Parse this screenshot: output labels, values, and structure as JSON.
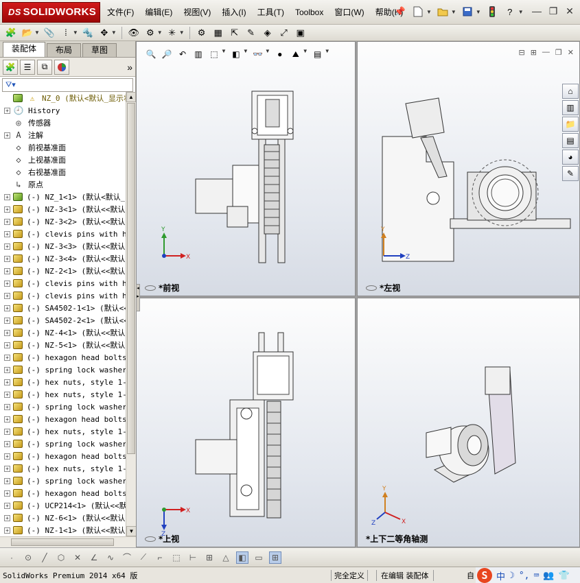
{
  "app": {
    "logo_text": "SOLIDWORKS",
    "logo_mark": "DS"
  },
  "menu": [
    "文件(F)",
    "编辑(E)",
    "视图(V)",
    "插入(I)",
    "工具(T)",
    "Toolbox",
    "窗口(W)",
    "帮助(H)"
  ],
  "left_tabs": {
    "assembly": "装配体",
    "layout": "布局",
    "sketch": "草图"
  },
  "tree": {
    "root": "NZ_0  (默认<默认_显示状",
    "items": [
      {
        "label": "History",
        "icon": "history-icon",
        "expand": true
      },
      {
        "label": "传感器",
        "icon": "sensor-icon",
        "expand": false
      },
      {
        "label": "注解",
        "icon": "annotation-icon",
        "expand": true
      },
      {
        "label": "前视基准面",
        "icon": "plane-icon",
        "expand": false
      },
      {
        "label": "上视基准面",
        "icon": "plane-icon",
        "expand": false
      },
      {
        "label": "右视基准面",
        "icon": "plane-icon",
        "expand": false
      },
      {
        "label": "原点",
        "icon": "origin-icon",
        "expand": false
      },
      {
        "label": "(-) NZ_1<1> (默认<默认_",
        "icon": "subassembly-icon",
        "expand": true
      },
      {
        "label": "(-) NZ-3<1> (默认<<默认",
        "icon": "part-icon",
        "expand": true
      },
      {
        "label": "(-) NZ-3<2> (默认<<默认",
        "icon": "part-icon",
        "expand": true
      },
      {
        "label": "(-) clevis pins with he",
        "icon": "part-icon",
        "expand": true
      },
      {
        "label": "(-) NZ-3<3> (默认<<默认",
        "icon": "part-icon",
        "expand": true
      },
      {
        "label": "(-) NZ-3<4> (默认<<默认",
        "icon": "part-icon",
        "expand": true
      },
      {
        "label": "(-) NZ-2<1> (默认<<默认",
        "icon": "part-icon",
        "expand": true
      },
      {
        "label": "(-) clevis pins with he",
        "icon": "part-icon",
        "expand": true
      },
      {
        "label": "(-) clevis pins with he",
        "icon": "part-icon",
        "expand": true
      },
      {
        "label": "(-) SA4502-1<1> (默认<<",
        "icon": "part-icon",
        "expand": true
      },
      {
        "label": "(-) SA4502-2<1> (默认<<",
        "icon": "part-icon",
        "expand": true
      },
      {
        "label": "(-) NZ-4<1> (默认<<默认",
        "icon": "part-icon",
        "expand": true
      },
      {
        "label": "(-) NZ-5<1> (默认<<默认",
        "icon": "part-icon",
        "expand": true
      },
      {
        "label": "(-) hexagon head bolts-",
        "icon": "part-icon",
        "expand": true
      },
      {
        "label": "(-) spring lock washers",
        "icon": "part-icon",
        "expand": true
      },
      {
        "label": "(-) hex nuts, style 1-g",
        "icon": "part-icon",
        "expand": true
      },
      {
        "label": "(-) hex nuts, style 1-g",
        "icon": "part-icon",
        "expand": true
      },
      {
        "label": "(-) spring lock washers",
        "icon": "part-icon",
        "expand": true
      },
      {
        "label": "(-) hexagon head bolts-",
        "icon": "part-icon",
        "expand": true
      },
      {
        "label": "(-) hex nuts, style 1-g",
        "icon": "part-icon",
        "expand": true
      },
      {
        "label": "(-) spring lock washers",
        "icon": "part-icon",
        "expand": true
      },
      {
        "label": "(-) hexagon head bolts-",
        "icon": "part-icon",
        "expand": true
      },
      {
        "label": "(-) hex nuts, style 1-g",
        "icon": "part-icon",
        "expand": true
      },
      {
        "label": "(-) spring lock washers",
        "icon": "part-icon",
        "expand": true
      },
      {
        "label": "(-) hexagon head bolts-",
        "icon": "part-icon",
        "expand": true
      },
      {
        "label": "(-) UCP214<1> (默认<<默",
        "icon": "part-icon",
        "expand": true
      },
      {
        "label": "(-) NZ-6<1> (默认<<默认",
        "icon": "part-icon",
        "expand": true
      },
      {
        "label": "(-) NZ-1<1> (默认<<默认",
        "icon": "part-icon",
        "expand": true
      }
    ]
  },
  "views": {
    "front": "*前视",
    "left": "*左视",
    "top": "*上视",
    "iso": "*上下二等角轴测"
  },
  "status": {
    "version": "SolidWorks Premium 2014 x64 版",
    "defined": "完全定义",
    "editing": "在编辑 装配体",
    "extra": "自"
  },
  "ime": {
    "lang": "中"
  },
  "colors": {
    "logo_red": "#c00f0f",
    "viewport_bg": "#eef1f5",
    "axis_y": "#2e9a2e",
    "axis_x": "#d02020",
    "axis_z": "#2040c0"
  }
}
